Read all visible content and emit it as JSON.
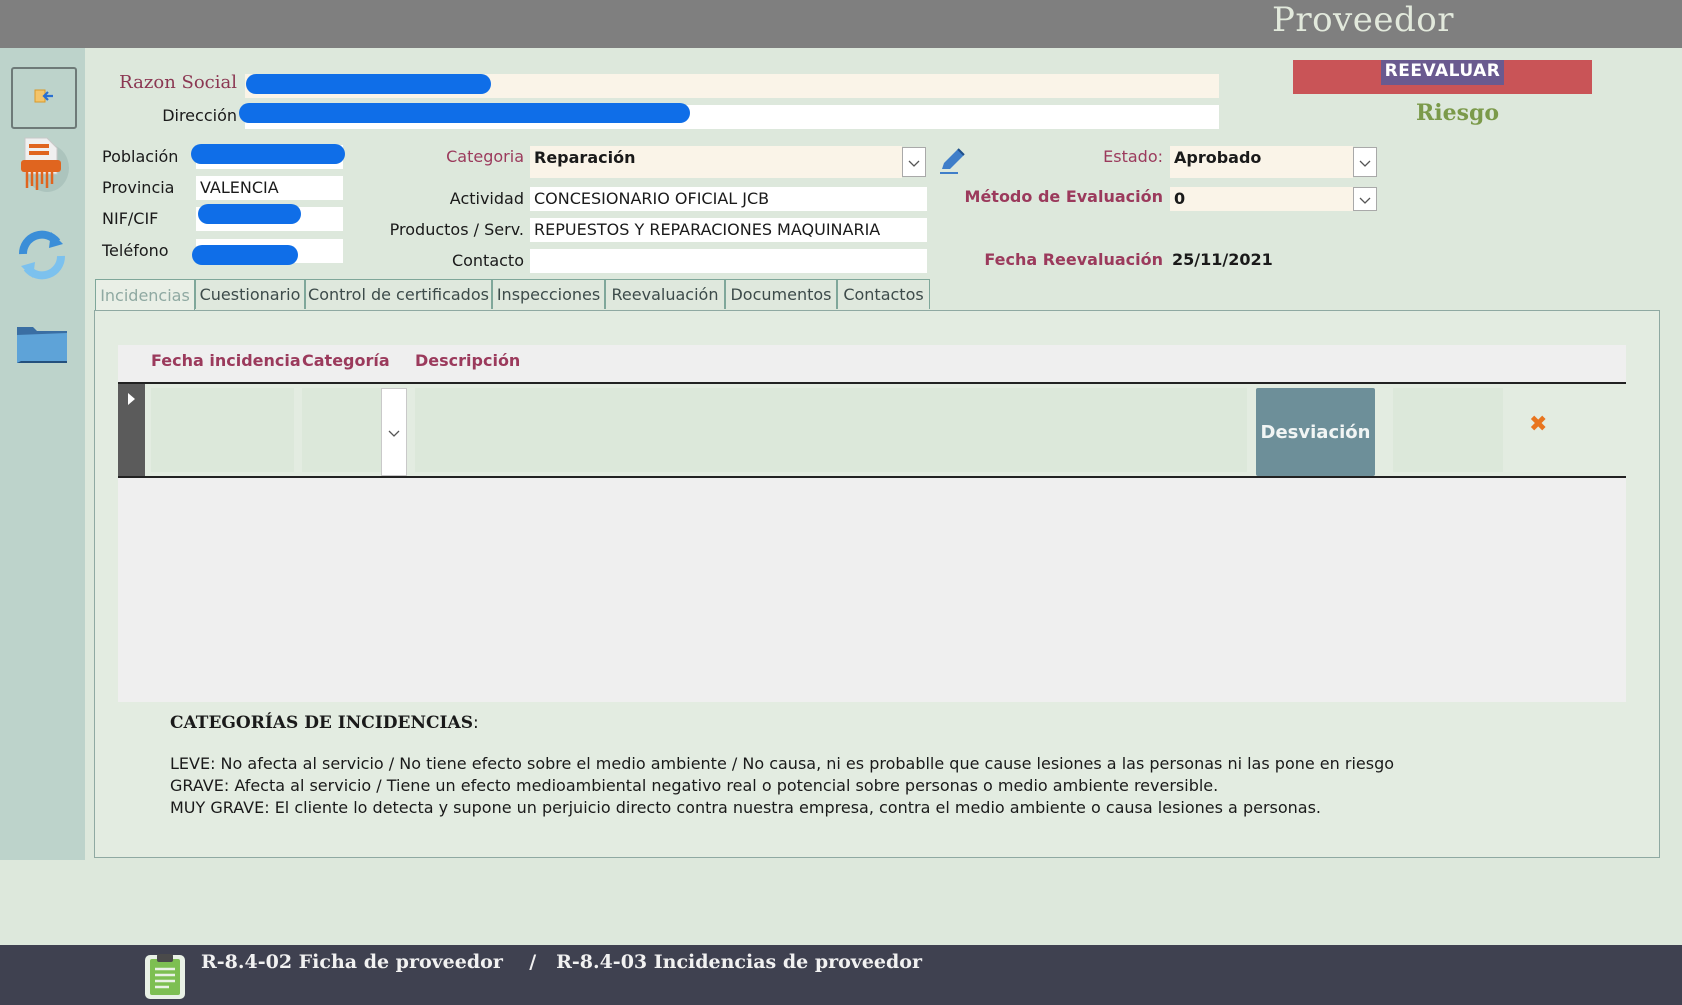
{
  "app_title": "Proveedor",
  "sidebar": {
    "icons": [
      "exit-icon",
      "pdf-document-icon",
      "refresh-icon",
      "folder-icon"
    ]
  },
  "header": {
    "razon_social_label": "Razon Social",
    "razon_social_value": "",
    "direccion_label": "Dirección",
    "direccion_value": "",
    "poblacion_label": "Población",
    "poblacion_value": "",
    "provincia_label": "Provincia",
    "provincia_value": "VALENCIA",
    "nif_label": "NIF/CIF",
    "nif_value": "",
    "telefono_label": "Teléfono",
    "telefono_value": "",
    "categoria_label": "Categoria",
    "categoria_value": "Reparación",
    "actividad_label": "Actividad",
    "actividad_value": "CONCESIONARIO OFICIAL JCB",
    "productos_label": "Productos / Serv.",
    "productos_value": "REPUESTOS Y REPARACIONES MAQUINARIA",
    "contacto_label": "Contacto",
    "contacto_value": "",
    "estado_label": "Estado:",
    "estado_value": "Aprobado",
    "metodo_label": "Método de Evaluación",
    "metodo_value": "0",
    "fecha_label": "Fecha Reevaluación",
    "fecha_value": "25/11/2021",
    "reevaluar_label": "REEVALUAR",
    "riesgo_label": "Riesgo"
  },
  "tabs": [
    {
      "label": "Incidencias",
      "active": true
    },
    {
      "label": "Cuestionario"
    },
    {
      "label": "Control de certificados"
    },
    {
      "label": "Inspecciones"
    },
    {
      "label": "Reevaluación"
    },
    {
      "label": "Documentos"
    },
    {
      "label": "Contactos"
    }
  ],
  "incidencias": {
    "columns": [
      "Fecha incidencia",
      "Categoría",
      "Descripción"
    ],
    "desviacion_label": "Desviación",
    "delete_symbol": "✖"
  },
  "categorias": {
    "title": "CATEGORÍAS DE INCIDENCIAS",
    "title_suffix": ":",
    "lines": [
      "LEVE: No afecta al servicio / No tiene efecto sobre el medio ambiente / No causa, ni  es probablle que cause lesiones a las personas ni las pone en riesgo",
      "GRAVE: Afecta al servicio / Tiene un efecto medioambiental negativo real o potencial  sobre personas o medio ambiente reversible.",
      "MUY GRAVE: El cliente lo detecta y supone un perjuicio directo contra nuestra empresa, contra el medio ambiente o causa lesiones a personas."
    ]
  },
  "footer": {
    "text": "R-8.4-02 Ficha de proveedor    /   R-8.4-03 Incidencias de proveedor"
  },
  "colors": {
    "background": "#dde8dc",
    "sidebar": "#bdd3cb",
    "accent_red": "#c95457",
    "label_red": "#9b3a5c",
    "riesgo_green": "#7b9a4a",
    "footer": "#3f4150"
  }
}
